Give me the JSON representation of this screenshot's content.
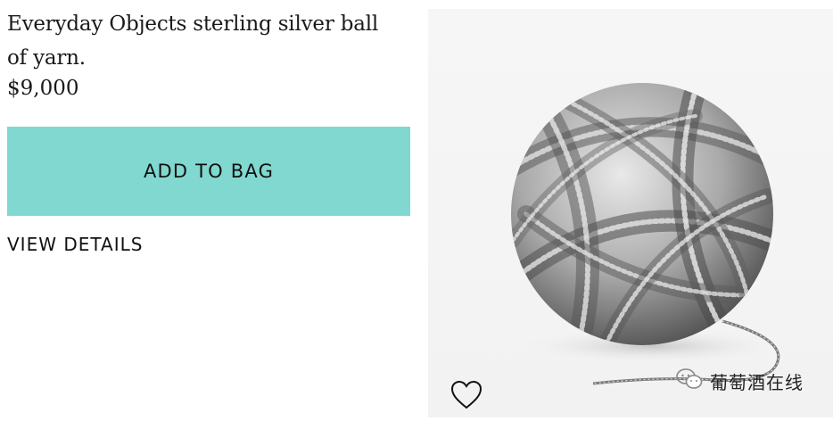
{
  "product": {
    "title": "Everyday Objects sterling silver ball of yarn.",
    "price": "$9,000",
    "image_subject": "sterling silver ball of yarn"
  },
  "actions": {
    "add_to_bag_label": "ADD TO BAG",
    "view_details_label": "VIEW DETAILS"
  },
  "icons": {
    "wishlist": "heart-outline-icon",
    "watermark": "wechat-icon"
  },
  "watermark": {
    "text": "葡萄酒在线"
  },
  "colors": {
    "accent": "#81d8d0",
    "text": "#1a1a1a"
  }
}
